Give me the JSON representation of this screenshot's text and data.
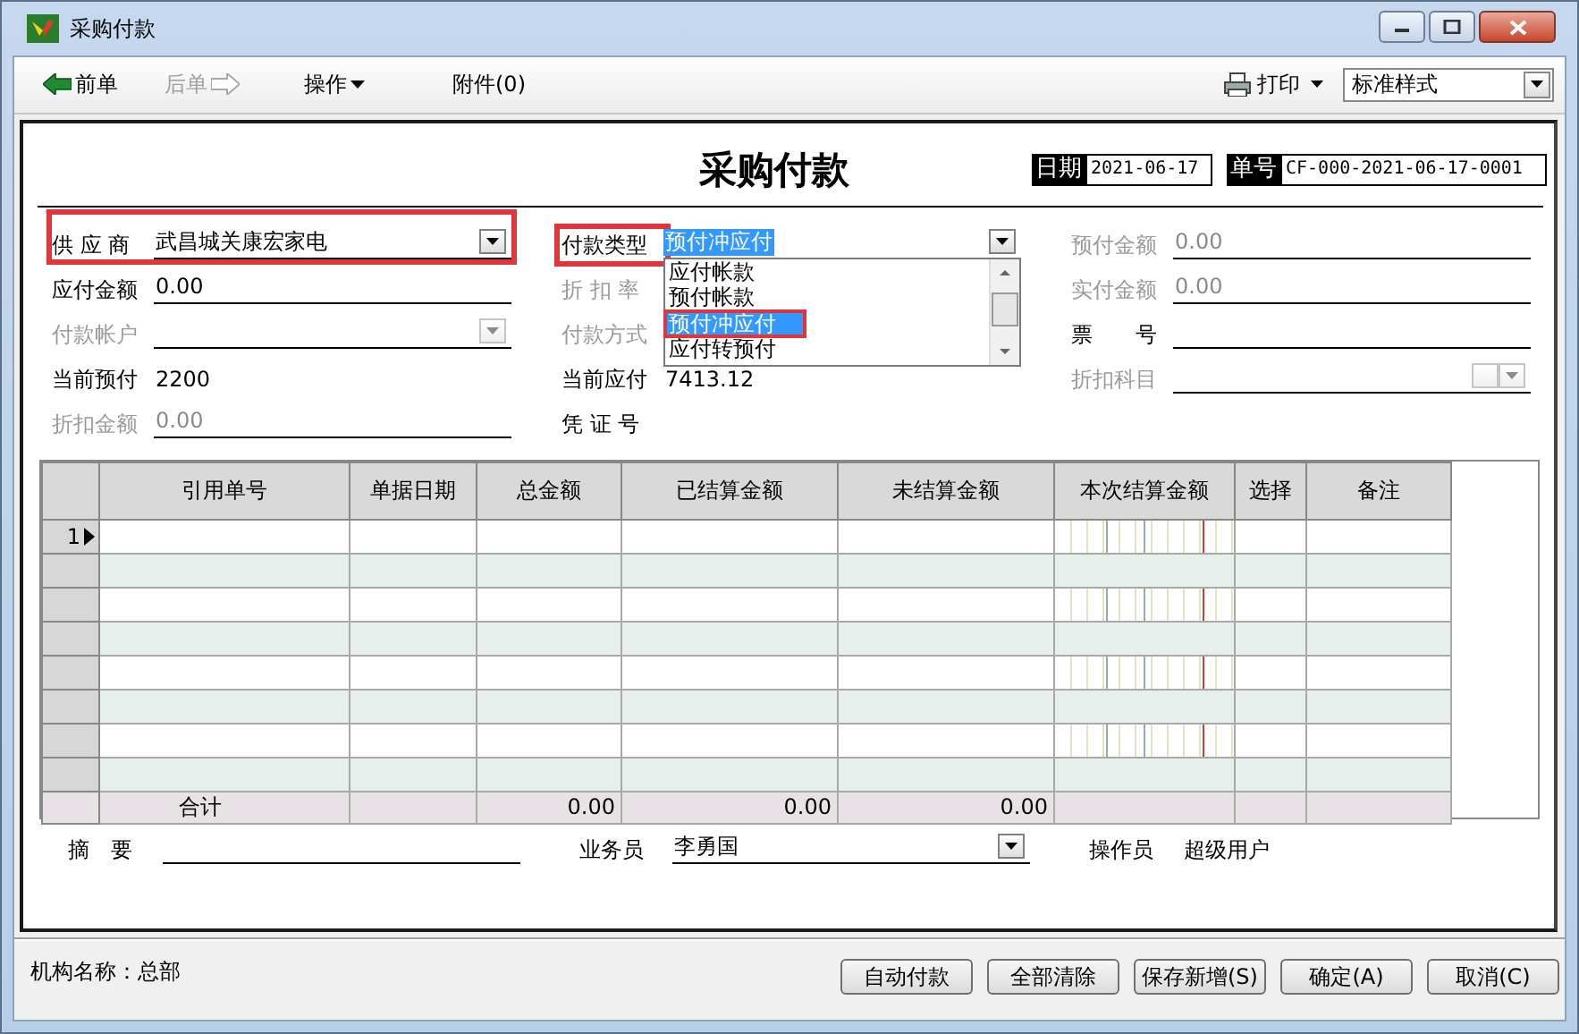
{
  "window": {
    "title": "采购付款"
  },
  "toolbar": {
    "items": [
      {
        "kind": "back",
        "label": "前单",
        "disabled": false
      },
      {
        "kind": "forward",
        "label": "后单",
        "disabled": true
      },
      {
        "kind": "menu",
        "label": "操作",
        "disabled": false
      },
      {
        "kind": "plain",
        "label": "附件(0)",
        "disabled": false
      }
    ],
    "print": {
      "label": "打印"
    },
    "style_select": {
      "value": "标准样式"
    }
  },
  "form": {
    "title": "采购付款",
    "date": {
      "label": "日期",
      "value": "2021-06-17"
    },
    "number": {
      "label": "单号",
      "value": "CF-000-2021-06-17-0001"
    },
    "columns": [
      {
        "fields": [
          {
            "label": "供 应 商",
            "kind": "combo",
            "value": "武昌城关康宏家电",
            "disabled": false,
            "row_annotated": true
          },
          {
            "label": "应付金额",
            "kind": "text",
            "value": "0.00",
            "disabled": false
          },
          {
            "label": "付款帐户",
            "kind": "combo",
            "disabled": true
          },
          {
            "label": "当前预付",
            "kind": "readout",
            "value": "2200",
            "disabled": false
          },
          {
            "label": "折扣金额",
            "kind": "text",
            "value": "0.00",
            "disabled": true
          }
        ]
      },
      {
        "fields": [
          {
            "label": "付款类型",
            "kind": "combo",
            "value": "预付冲应付",
            "value_selected": true,
            "disabled": false,
            "label_annotated": true,
            "dropdown": [
              {
                "label": "应付帐款",
                "selected": false,
                "annotated": false
              },
              {
                "label": "预付帐款",
                "selected": false,
                "annotated": false
              },
              {
                "label": "预付冲应付",
                "selected": true,
                "annotated": true
              },
              {
                "label": "应付转预付",
                "selected": false,
                "annotated": false
              }
            ]
          },
          {
            "label": "折 扣 率",
            "kind": "readout",
            "disabled": true
          },
          {
            "label": "付款方式",
            "kind": "readout",
            "disabled": true
          },
          {
            "label": "当前应付",
            "kind": "readout",
            "value": "7413.12",
            "disabled": false
          },
          {
            "label": "凭 证 号",
            "kind": "readout",
            "disabled": false
          }
        ]
      },
      {
        "fields": [
          {
            "label": "预付金额",
            "kind": "text",
            "value": "0.00",
            "disabled": true
          },
          {
            "label": "实付金额",
            "kind": "text",
            "value": "0.00",
            "disabled": true
          },
          {
            "label": "票　　号",
            "kind": "text",
            "disabled": false
          },
          {
            "label": "折扣科目",
            "kind": "combo2",
            "disabled": true
          }
        ]
      }
    ]
  },
  "grid": {
    "columns": [
      {
        "label": "引用单号",
        "kind": "text"
      },
      {
        "label": "单据日期",
        "kind": "text"
      },
      {
        "label": "总金额",
        "kind": "number"
      },
      {
        "label": "已结算金额",
        "kind": "number"
      },
      {
        "label": "未结算金额",
        "kind": "number"
      },
      {
        "label": "本次结算金额",
        "kind": "money"
      },
      {
        "label": "选择",
        "kind": "text"
      },
      {
        "label": "备注",
        "kind": "text"
      }
    ],
    "rows": [
      {
        "header": "1",
        "current": true
      },
      {
        "current": false
      },
      {
        "current": false
      },
      {
        "current": false
      },
      {
        "current": false
      },
      {
        "current": false
      },
      {
        "current": false
      },
      {
        "current": false
      }
    ],
    "total": {
      "label": "合计",
      "values": [
        "0.00",
        "0.00",
        "0.00"
      ]
    }
  },
  "summary_fields": [
    {
      "label": "摘　要",
      "kind": "text",
      "disabled": false
    },
    {
      "label": "业务员",
      "kind": "combo",
      "value": "李勇国",
      "disabled": false
    },
    {
      "label": "操作员",
      "kind": "readout",
      "value": "超级用户",
      "disabled": false
    }
  ],
  "status_bar": {
    "org": "机构名称：总部",
    "buttons": [
      "自动付款",
      "全部清除",
      "保存新增(S)",
      "确定(A)",
      "取消(C)"
    ]
  }
}
